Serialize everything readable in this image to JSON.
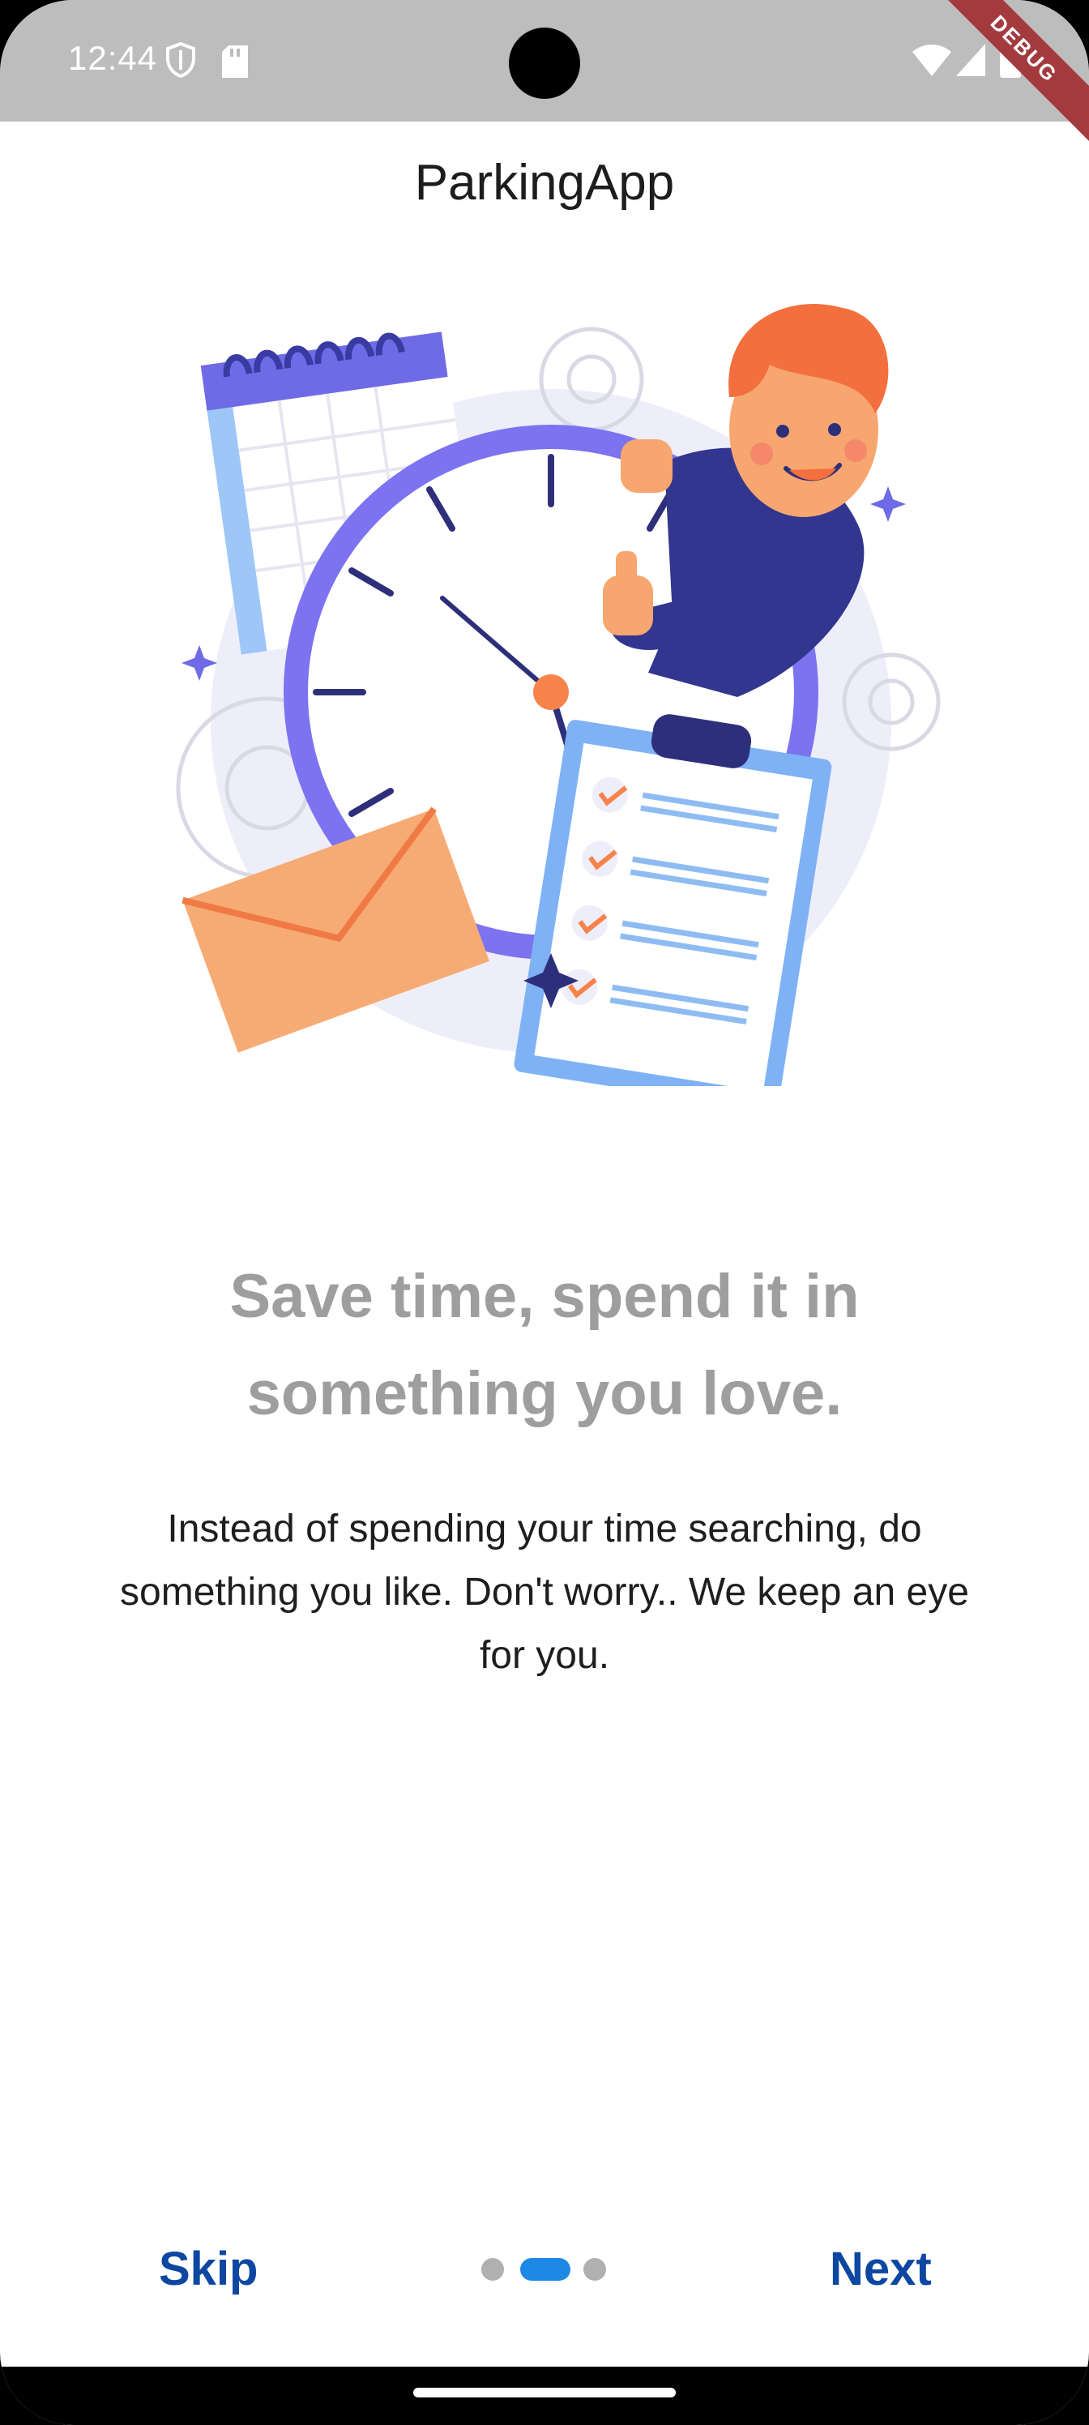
{
  "status_bar": {
    "time": "12:44"
  },
  "debug_banner": "DEBUG",
  "app_bar": {
    "title": "ParkingApp"
  },
  "onboarding": {
    "headline_line1": "Save time, spend it in",
    "headline_line2": "something you love.",
    "body_line1": "Instead of spending your time searching, do",
    "body_line2": "something you like. Don't worry.. We keep an eye",
    "body_line3": "for you.",
    "page_index": 2,
    "page_count": 3
  },
  "controls": {
    "skip_label": "Skip",
    "next_label": "Next"
  },
  "colors": {
    "status_bar": "#bdbdbd",
    "headline": "#9e9e9e",
    "button_text": "#0d47a1",
    "active_dot": "#1e88e5",
    "inactive_dot": "#b0b0b0",
    "illustration_purple": "#6f6ae6",
    "illustration_navy": "#2e2f7a",
    "illustration_orange": "#f7a66f"
  },
  "icons": [
    "shield-icon",
    "sd-card-icon",
    "wifi-icon",
    "signal-icon",
    "battery-icon"
  ]
}
